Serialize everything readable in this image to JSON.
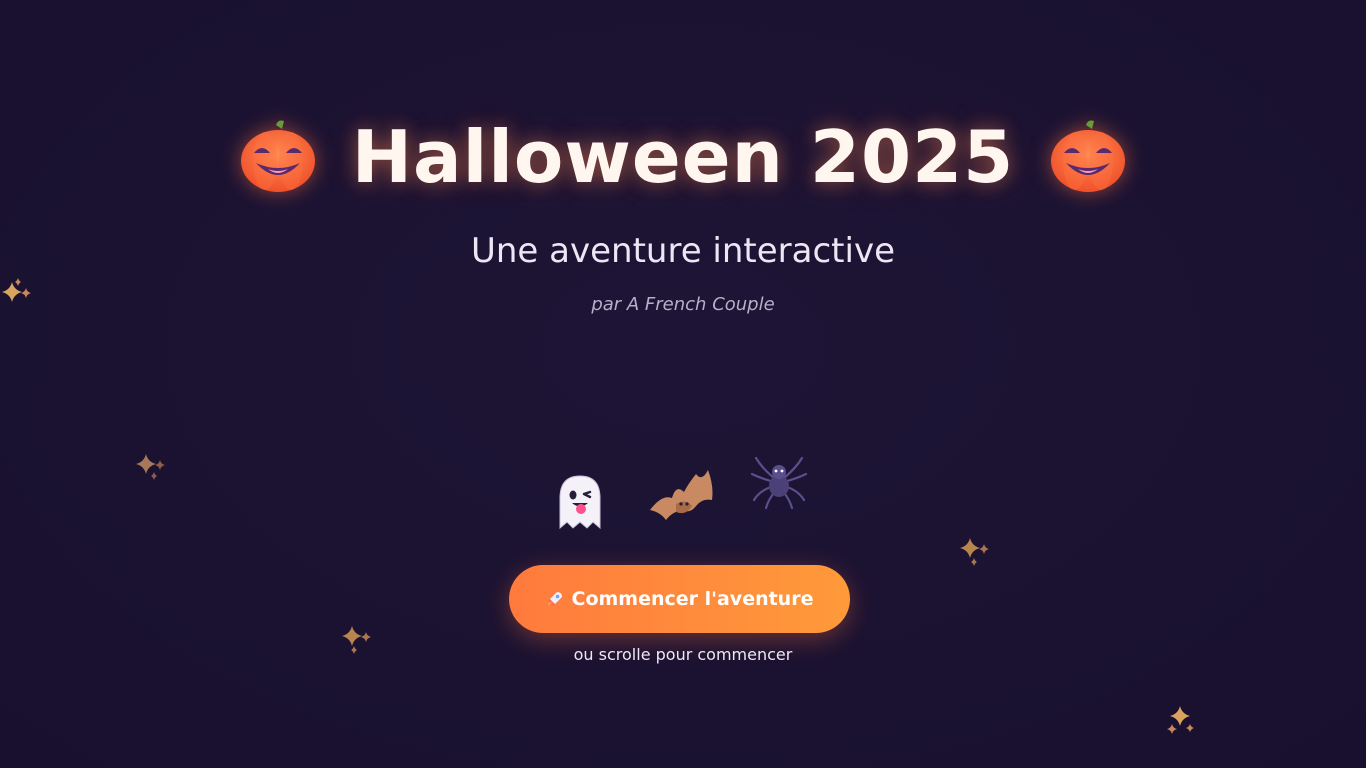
{
  "hero": {
    "title": "Halloween 2025",
    "subtitle": "Une aventure interactive",
    "byline": "par A French Couple",
    "left_icon": "pumpkin-icon",
    "right_icon": "pumpkin-icon"
  },
  "creatures": [
    "ghost-icon",
    "bat-icon",
    "spider-icon"
  ],
  "cta": {
    "label": "Commencer l'aventure",
    "icon": "rocket-icon",
    "hint": "ou scrolle pour commencer"
  },
  "decorations": {
    "sparkle_icon": "sparkles-icon"
  },
  "colors": {
    "background": "#1b1231",
    "accent": "#ff8a3c",
    "title": "#fff7ef",
    "subtitle": "#ece6f5",
    "byline": "#b7afc7"
  }
}
